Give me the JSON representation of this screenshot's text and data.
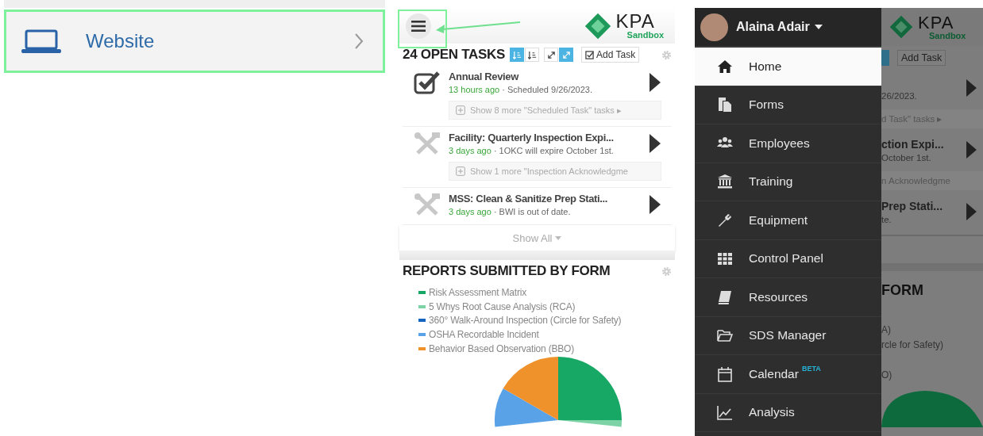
{
  "help_row": {
    "label": "Website"
  },
  "app": {
    "logo": {
      "name": "KPA",
      "sub": "Sandbox"
    },
    "tasks": {
      "title": "24 OPEN TASKS",
      "sort_buttons": [
        {
          "selected": true
        },
        {
          "selected": false
        }
      ],
      "size_buttons": [
        {
          "selected": false
        },
        {
          "selected": true
        }
      ],
      "add_label": "Add Task",
      "items": [
        {
          "kind": "scheduled",
          "title": "Annual Review",
          "time": "13 hours ago",
          "detail": "· Scheduled 9/26/2023.",
          "more": "Show 8 more \"Scheduled Task\" tasks ▸"
        },
        {
          "kind": "inspection",
          "title": "Facility: Quarterly Inspection Expi...",
          "time": "3 days ago",
          "detail": "· 1OKC will expire October 1st.",
          "more": "Show 1 more \"Inspection Acknowledgme"
        },
        {
          "kind": "inspection",
          "title": "MSS: Clean & Sanitize Prep Stati...",
          "time": "3 days ago",
          "detail": "· BWI is out of date."
        }
      ],
      "show_all": "Show All"
    },
    "reports": {
      "title": "REPORTS SUBMITTED BY FORM",
      "legend": [
        {
          "label": "Risk Assessment Matrix",
          "color": "#17a865"
        },
        {
          "label": "5 Whys Root Cause Analysis (RCA)",
          "color": "#7dd3a6"
        },
        {
          "label": "360° Walk-Around Inspection (Circle for Safety)",
          "color": "#1565c0"
        },
        {
          "label": "OSHA Recordable Incident",
          "color": "#5aa2e8"
        },
        {
          "label": "Behavior Based Observation (BBO)",
          "color": "#f0922b"
        }
      ]
    }
  },
  "drawer": {
    "user": "Alaina Adair",
    "items": [
      {
        "label": "Home",
        "selected": true
      },
      {
        "label": "Forms",
        "selected": false
      },
      {
        "label": "Employees",
        "selected": false
      },
      {
        "label": "Training",
        "selected": false
      },
      {
        "label": "Equipment",
        "selected": false
      },
      {
        "label": "Control Panel",
        "selected": false
      },
      {
        "label": "Resources",
        "selected": false
      },
      {
        "label": "SDS Manager",
        "selected": false
      },
      {
        "label": "Calendar",
        "selected": false,
        "badge": "BETA"
      },
      {
        "label": "Analysis",
        "selected": false
      }
    ]
  },
  "peek": {
    "logo": {
      "name": "KPA",
      "sub": "Sandbox"
    },
    "add_label": "Add Task",
    "task_1_detail": "26/2023.",
    "more_1": "d Task\" tasks ▸",
    "task_2_title": "ction Expi...",
    "task_2_detail": "October 1st.",
    "more_2": "n Acknowledgme",
    "task_3_title": "Prep Stati...",
    "task_3_detail": "te.",
    "reports_title": "FORM",
    "legend": [
      {
        "text": "A)"
      },
      {
        "text": "rcle for Safety)"
      },
      {
        "text": "O)"
      }
    ]
  }
}
